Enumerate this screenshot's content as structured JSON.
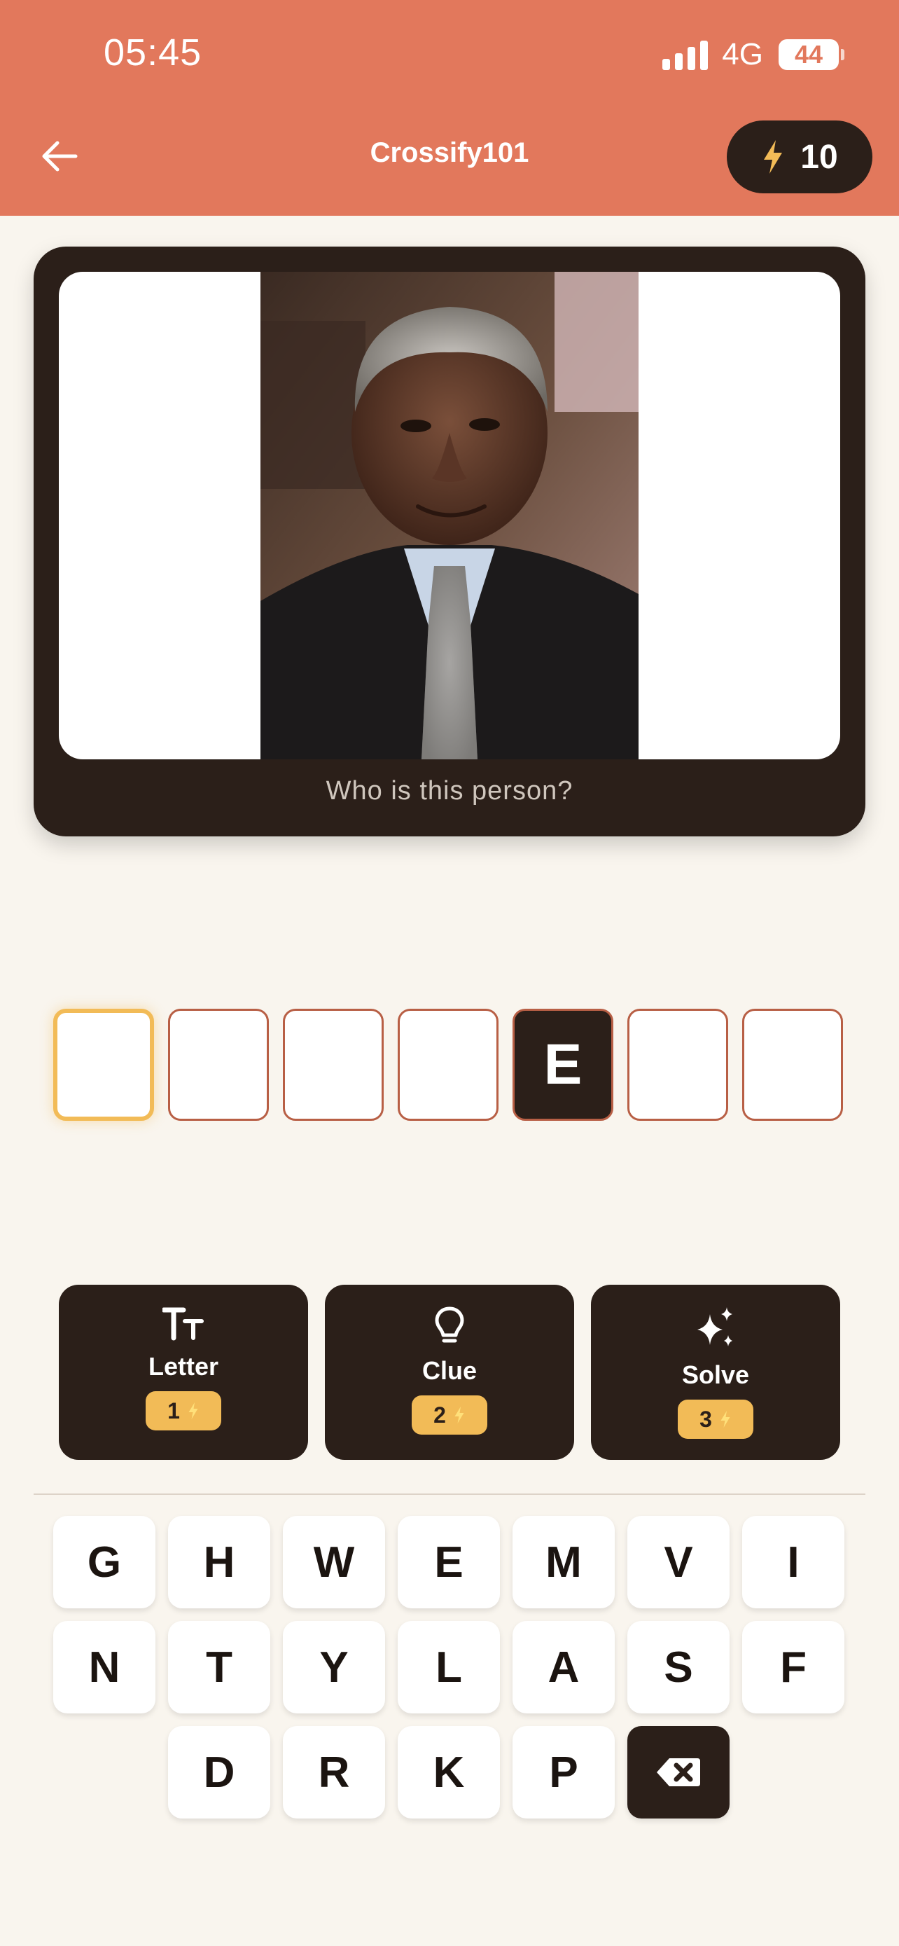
{
  "status_bar": {
    "time": "05:45",
    "network": "4G",
    "battery": "44"
  },
  "header": {
    "title": "Crossify101",
    "energy": "10"
  },
  "puzzle": {
    "question": "Who is this person?"
  },
  "answer_slots": [
    "",
    "",
    "",
    "",
    "E",
    "",
    ""
  ],
  "powerups": [
    {
      "label": "Letter",
      "cost": "1",
      "icon": "text-size-icon"
    },
    {
      "label": "Clue",
      "cost": "2",
      "icon": "lightbulb-icon"
    },
    {
      "label": "Solve",
      "cost": "3",
      "icon": "sparkles-icon"
    }
  ],
  "keyboard": {
    "row1": [
      "G",
      "H",
      "W",
      "E",
      "M",
      "V",
      "I"
    ],
    "row2": [
      "N",
      "T",
      "Y",
      "L",
      "A",
      "S",
      "F"
    ],
    "row3": [
      "D",
      "R",
      "K",
      "P"
    ]
  },
  "colors": {
    "header": "#e2785c",
    "dark": "#2b1f19",
    "accent": "#f2bb57",
    "background": "#f9f5ee"
  }
}
